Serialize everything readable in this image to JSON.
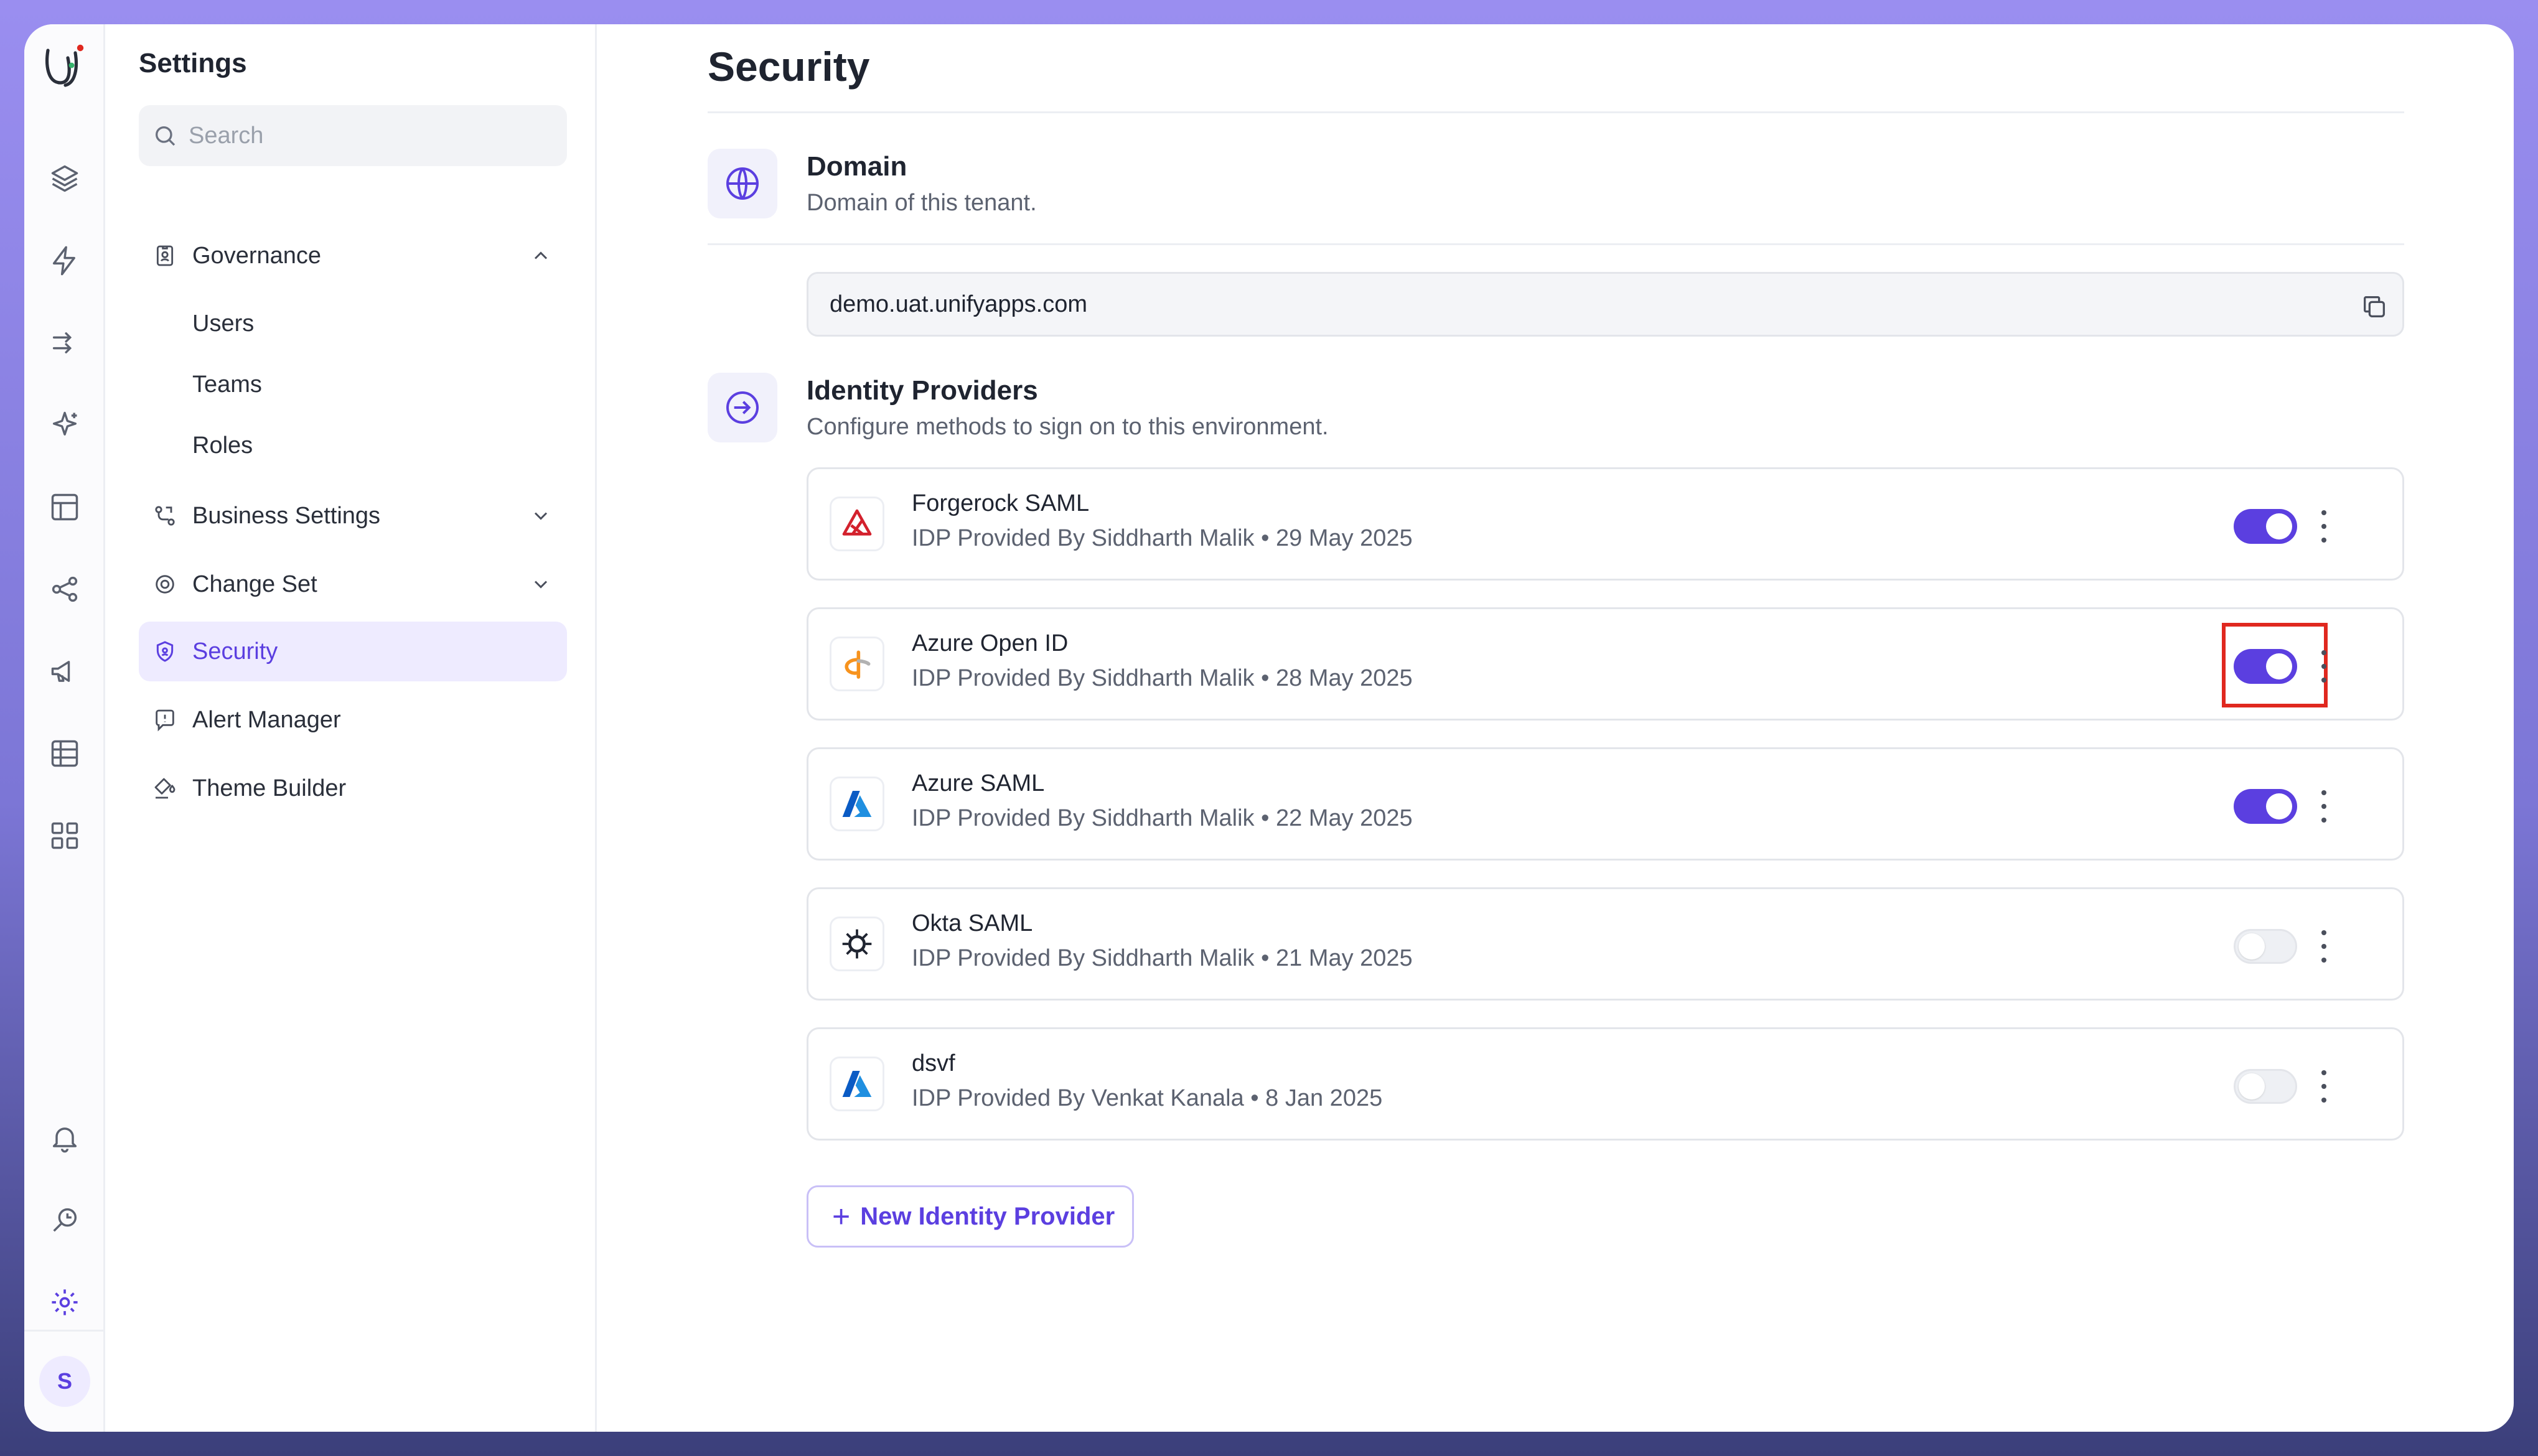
{
  "colors": {
    "accent": "#5b3fe0",
    "highlight": "#e0281f"
  },
  "rail": {
    "icons": [
      "unifyapps-logo",
      "layers-icon",
      "lightning-icon",
      "flow-icon",
      "sparkle-icon",
      "layout-icon",
      "share-icon",
      "megaphone-icon",
      "table-icon",
      "apps-grid-icon",
      "bell-icon",
      "search-help-icon",
      "gear-icon"
    ],
    "avatar": "S"
  },
  "nav": {
    "title": "Settings",
    "search_placeholder": "Search",
    "items": [
      {
        "label": "Governance",
        "icon": "badge-icon",
        "expanded": true
      },
      {
        "label": "Business Settings",
        "icon": "branch-icon"
      },
      {
        "label": "Change Set",
        "icon": "target-icon"
      },
      {
        "label": "Security",
        "icon": "shield-icon",
        "active": true
      },
      {
        "label": "Alert Manager",
        "icon": "alert-icon"
      },
      {
        "label": "Theme Builder",
        "icon": "paint-bucket-icon"
      }
    ],
    "governance_sub": [
      "Users",
      "Teams",
      "Roles"
    ]
  },
  "main": {
    "title": "Security",
    "domain": {
      "title": "Domain",
      "description": "Domain of this tenant.",
      "value": "demo.uat.unifyapps.com"
    },
    "idp": {
      "title": "Identity Providers",
      "description": "Configure methods to sign on to this environment.",
      "providers": [
        {
          "name": "Forgerock SAML",
          "meta": "IDP Provided By Siddharth Malik • 29 May 2025",
          "enabled": true,
          "logo": "forgerock-logo"
        },
        {
          "name": "Azure Open ID",
          "meta": "IDP Provided By Siddharth Malik • 28 May 2025",
          "enabled": true,
          "logo": "openid-logo",
          "highlighted": true
        },
        {
          "name": "Azure SAML",
          "meta": "IDP Provided By Siddharth Malik • 22 May 2025",
          "enabled": true,
          "logo": "azure-logo"
        },
        {
          "name": "Okta SAML",
          "meta": "IDP Provided By Siddharth Malik • 21 May 2025",
          "enabled": false,
          "logo": "okta-logo"
        },
        {
          "name": "dsvf",
          "meta": "IDP Provided By Venkat Kanala • 8 Jan 2025",
          "enabled": false,
          "logo": "azure-logo"
        }
      ],
      "new_button": "New Identity Provider"
    }
  }
}
